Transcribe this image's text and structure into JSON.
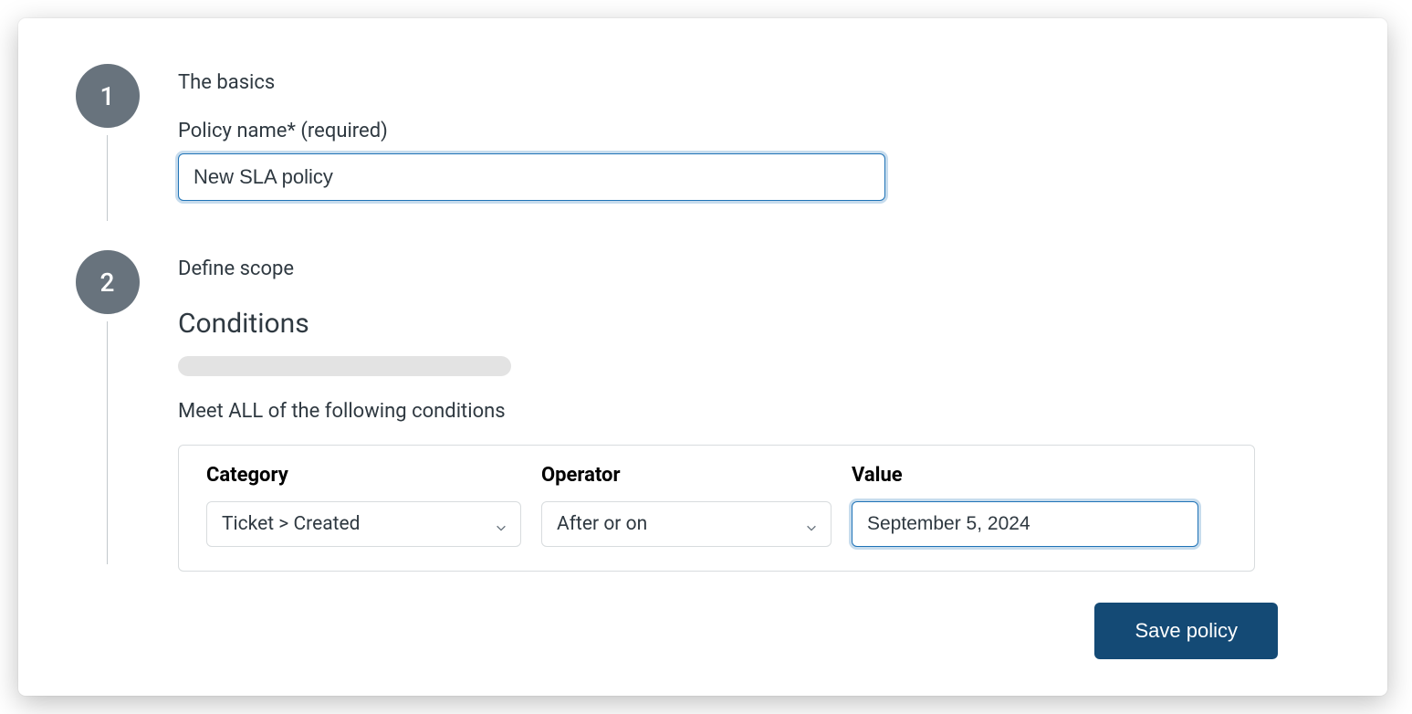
{
  "step1": {
    "number": "1",
    "title": "The basics",
    "policy_name_label": "Policy name* (required)",
    "policy_name_value": "New SLA policy"
  },
  "step2": {
    "number": "2",
    "title": "Define scope",
    "section_heading": "Conditions",
    "conditions_intro": "Meet ALL of the following conditions",
    "columns": {
      "category_label": "Category",
      "operator_label": "Operator",
      "value_label": "Value"
    },
    "row": {
      "category_value": "Ticket > Created",
      "operator_value": "After or on",
      "value_value": "September 5, 2024"
    }
  },
  "actions": {
    "save_label": "Save policy"
  }
}
